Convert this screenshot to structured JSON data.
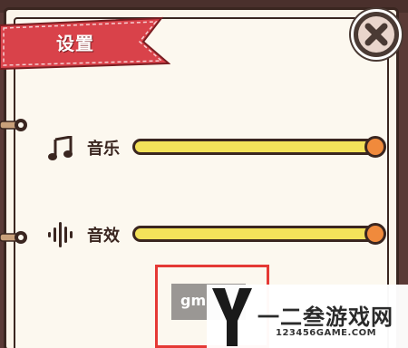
{
  "dialog": {
    "title": "设置",
    "close_icon": "close-x-icon"
  },
  "settings": [
    {
      "label": "音乐",
      "icon": "music-note-icon",
      "level": 1.0
    },
    {
      "label": "音效",
      "icon": "sound-wave-icon",
      "level": 1.0
    }
  ],
  "gm_button": {
    "label": "gm"
  },
  "watermark": {
    "brand": "一二叁游戏网",
    "url": "123456GAME.COM"
  },
  "colors": {
    "ribbon": "#d9424a",
    "track": "#f3e25a",
    "knob": "#f08a3c",
    "outline": "#3a2620",
    "panel": "#fbf5ea",
    "highlight": "#e53935"
  }
}
